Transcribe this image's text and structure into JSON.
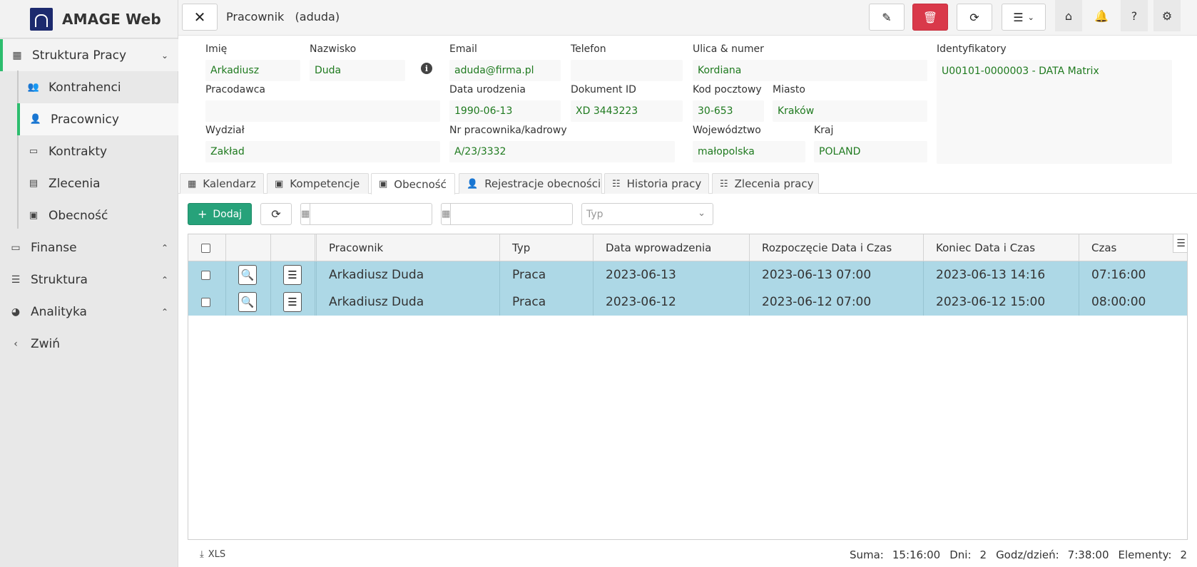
{
  "brand": {
    "name": "AMAGE Web"
  },
  "sidebar": {
    "items": [
      {
        "label": "Struktura Pracy",
        "icon": "building-icon",
        "chevron": "⌄"
      },
      {
        "label": "Finanse",
        "icon": "money-icon",
        "chevron": "⌃"
      },
      {
        "label": "Struktura",
        "icon": "sitemap-icon",
        "chevron": "⌃"
      },
      {
        "label": "Analityka",
        "icon": "gauge-icon",
        "chevron": "⌃"
      },
      {
        "label": "Zwiń",
        "icon": "chevron-left-icon"
      }
    ],
    "sub_items": [
      {
        "label": "Kontrahenci",
        "icon": "users-icon"
      },
      {
        "label": "Pracownicy",
        "icon": "user-tie-icon"
      },
      {
        "label": "Kontrakty",
        "icon": "money-bill-icon"
      },
      {
        "label": "Zlecenia",
        "icon": "clipboard-icon"
      },
      {
        "label": "Obecność",
        "icon": "id-card-icon"
      }
    ]
  },
  "header": {
    "close": "✕",
    "title": "Pracownik   (aduda)"
  },
  "form": {
    "labels": {
      "imie": "Imię",
      "nazwisko": "Nazwisko",
      "email": "Email",
      "telefon": "Telefon",
      "ulica": "Ulica & numer",
      "identyfikatory": "Identyfikatory",
      "pracodawca": "Pracodawca",
      "data_urodzenia": "Data urodzenia",
      "dokument": "Dokument ID",
      "kod": "Kod pocztowy",
      "miasto": "Miasto",
      "wydzial": "Wydział",
      "nr_pracownika": "Nr pracownika/kadrowy",
      "wojewodztwo": "Województwo",
      "kraj": "Kraj"
    },
    "values": {
      "imie": "Arkadiusz",
      "nazwisko": "Duda",
      "email": "aduda@firma.pl",
      "telefon": "",
      "ulica": "Kordiana",
      "identyfikatory": "U00101-0000003 - DATA Matrix",
      "pracodawca": "",
      "data_urodzenia": "1990-06-13",
      "dokument": "XD 3443223",
      "kod": "30-653",
      "miasto": "Kraków",
      "wydzial": "Zakład",
      "nr_pracownika": "A/23/3332",
      "wojewodztwo": "małopolska",
      "kraj": "POLAND"
    }
  },
  "tabs": [
    {
      "label": "Kalendarz",
      "icon": "calendar-icon"
    },
    {
      "label": "Kompetencje",
      "icon": "id-card-icon"
    },
    {
      "label": "Obecność",
      "icon": "id-card-icon",
      "active": true
    },
    {
      "label": "Rejestracje obecności",
      "icon": "user-clock-icon"
    },
    {
      "label": "Historia pracy",
      "icon": "list-icon"
    },
    {
      "label": "Zlecenia pracy",
      "icon": "list-icon"
    }
  ],
  "toolbar": {
    "add_label": "Dodaj",
    "date_from": "",
    "date_to": "",
    "type_placeholder": "Typ"
  },
  "table": {
    "columns": [
      "Pracownik",
      "Typ",
      "Data wprowadzenia",
      "Rozpoczęcie Data i Czas",
      "Koniec Data i Czas",
      "Czas"
    ],
    "rows": [
      [
        "Arkadiusz Duda",
        "Praca",
        "2023-06-13",
        "2023-06-13 07:00",
        "2023-06-13 14:16",
        "07:16:00"
      ],
      [
        "Arkadiusz Duda",
        "Praca",
        "2023-06-12",
        "2023-06-12 07:00",
        "2023-06-12 15:00",
        "08:00:00"
      ]
    ]
  },
  "footer": {
    "export_label": "XLS",
    "suma_label": "Suma:",
    "suma": "15:16:00",
    "dni_label": "Dni:",
    "dni": "2",
    "godz_label": "Godz/dzień:",
    "godz": "7:38:00",
    "elementy_label": "Elementy:",
    "elementy": "2"
  },
  "colors": {
    "accent_green": "#2dbd6e",
    "add_button": "#27a27a",
    "danger": "#d9394a",
    "row_selected": "#add8e6",
    "value_text": "#1f7a1f"
  }
}
